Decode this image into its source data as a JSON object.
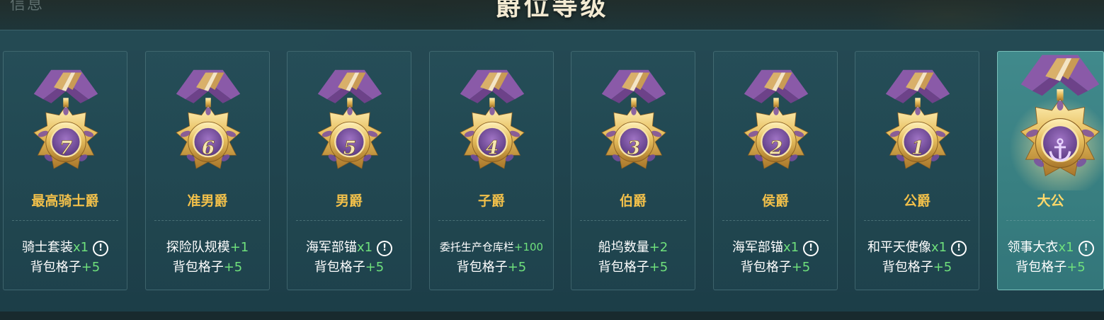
{
  "header": {
    "top_left_text": "信息",
    "title": "爵位等级"
  },
  "colors": {
    "rank_name": "#f2c04a",
    "reward_text": "#ffffff",
    "reward_bonus": "#6fe07c",
    "selected_card": "#3f9494"
  },
  "ranks": [
    {
      "medal_number": "7",
      "name": "最高骑士爵",
      "reward1_label": "骑士套装",
      "reward1_value": "x1",
      "reward1_info": "!",
      "reward2_label": "背包格子",
      "reward2_value": "+5"
    },
    {
      "medal_number": "6",
      "name": "准男爵",
      "reward1_label": "探险队规模",
      "reward1_value": "+1",
      "reward2_label": "背包格子",
      "reward2_value": "+5"
    },
    {
      "medal_number": "5",
      "name": "男爵",
      "reward1_label": "海军部锚",
      "reward1_value": "x1",
      "reward1_info": "!",
      "reward2_label": "背包格子",
      "reward2_value": "+5"
    },
    {
      "medal_number": "4",
      "name": "子爵",
      "reward1_label": "委托生产仓库栏",
      "reward1_value": "+100",
      "reward2_label": "背包格子",
      "reward2_value": "+5"
    },
    {
      "medal_number": "3",
      "name": "伯爵",
      "reward1_label": "船坞数量",
      "reward1_value": "+2",
      "reward2_label": "背包格子",
      "reward2_value": "+5"
    },
    {
      "medal_number": "2",
      "name": "侯爵",
      "reward1_label": "海军部锚",
      "reward1_value": "x1",
      "reward1_info": "!",
      "reward2_label": "背包格子",
      "reward2_value": "+5"
    },
    {
      "medal_number": "1",
      "name": "公爵",
      "reward1_label": "和平天使像",
      "reward1_value": "x1",
      "reward1_info": "!",
      "reward2_label": "背包格子",
      "reward2_value": "+5"
    },
    {
      "medal_number": "",
      "medal_icon": "anchor-icon",
      "name": "大公",
      "selected": true,
      "reward1_label": "领事大衣",
      "reward1_value": "x1",
      "reward1_info": "!",
      "reward2_label": "背包格子",
      "reward2_value": "+5"
    }
  ]
}
